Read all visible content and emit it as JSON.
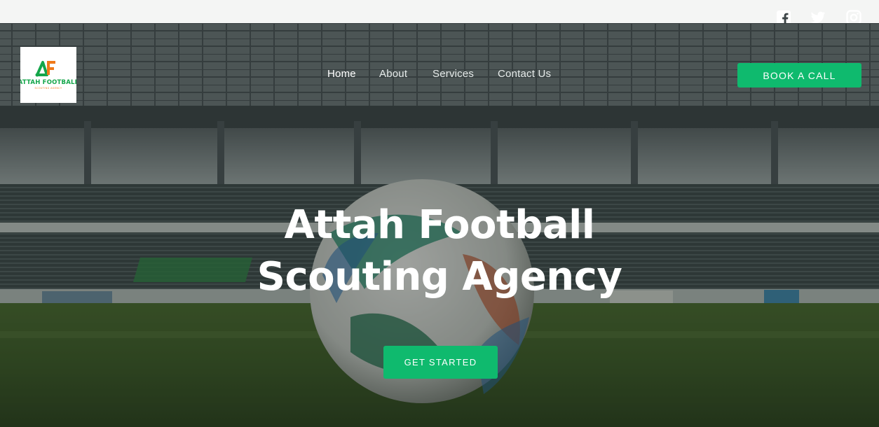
{
  "social": {
    "facebook_icon": "facebook-icon",
    "twitter_icon": "twitter-icon",
    "instagram_icon": "instagram-icon"
  },
  "logo": {
    "alt": "Attah Football logo",
    "text": "ATTAH FOOTBALL",
    "tagline": "SCOUTING AGENCY"
  },
  "nav": {
    "items": [
      {
        "label": "Home",
        "active": true
      },
      {
        "label": "About",
        "active": false
      },
      {
        "label": "Services",
        "active": false
      },
      {
        "label": "Contact Us",
        "active": false
      }
    ]
  },
  "header": {
    "cta_label": "BOOK A CALL"
  },
  "hero": {
    "title_line1": "Attah Football",
    "title_line2": "Scouting Agency",
    "cta_label": "GET STARTED"
  },
  "colors": {
    "accent": "#0fba6e",
    "topbar": "#f4f5f4",
    "logo_green": "#14a64a",
    "logo_orange": "#f07a1a"
  }
}
